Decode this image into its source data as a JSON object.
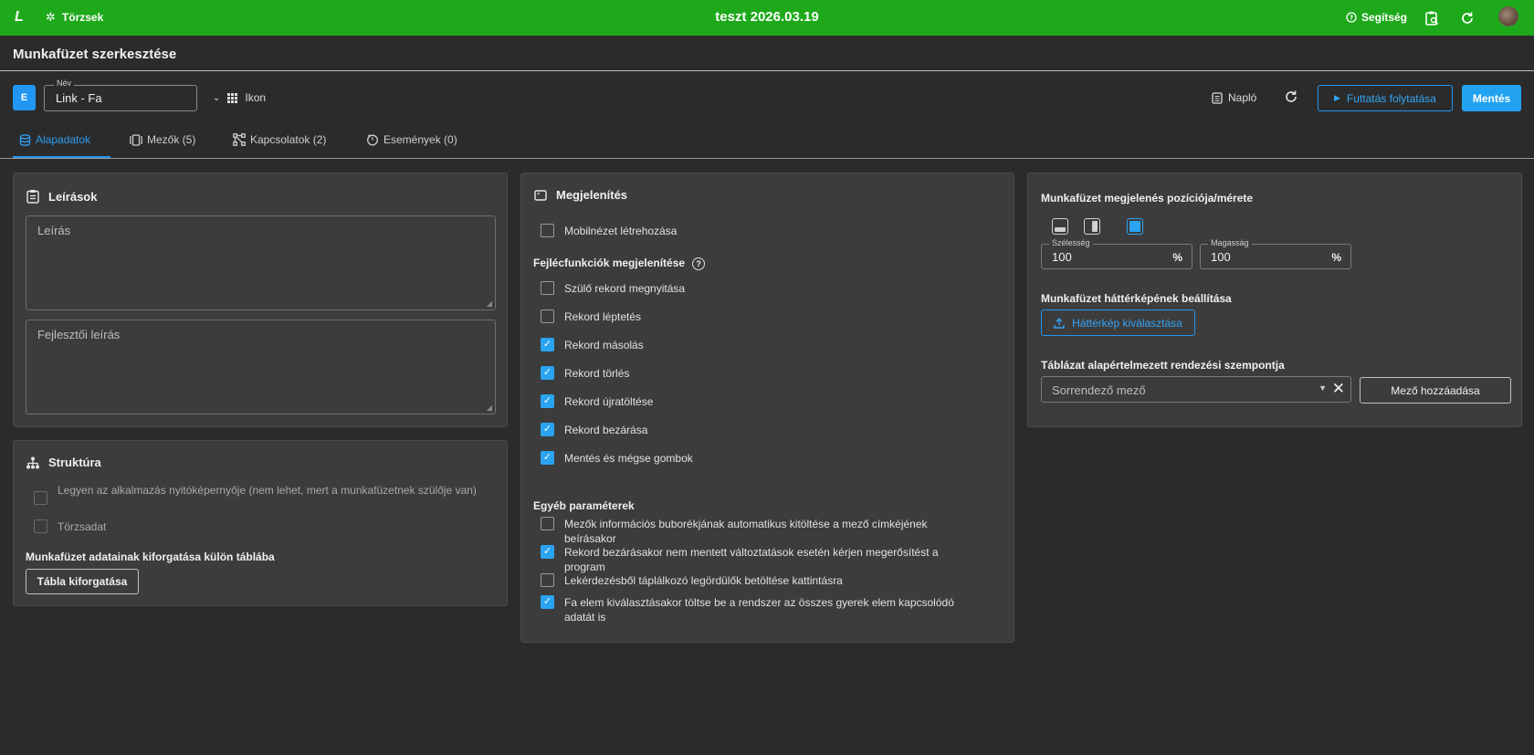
{
  "topbar": {
    "logo": "L",
    "torzsek_label": "Törzsek",
    "title": "teszt 2026.03.19",
    "help_label": "Segítség"
  },
  "header": {
    "page_title": "Munkafüzet szerkesztése",
    "badge": "E",
    "name_label": "Név",
    "name_value": "Link - Fa",
    "icon_label": "Ikon",
    "log_label": "Napló",
    "run_label": "Futtatás folytatása",
    "save_label": "Mentés"
  },
  "tabs": [
    {
      "label": "Alapadatok",
      "icon": "database-icon"
    },
    {
      "label": "Mezők (5)",
      "icon": "fields-icon"
    },
    {
      "label": "Kapcsolatok (2)",
      "icon": "relations-icon"
    },
    {
      "label": "Események (0)",
      "icon": "events-icon"
    }
  ],
  "descriptions": {
    "title": "Leírások",
    "desc_placeholder": "Leírás",
    "dev_desc_placeholder": "Fejlesztői leírás"
  },
  "structure": {
    "title": "Struktúra",
    "opt1": "Legyen az alkalmazás nyitóképernyője (nem lehet, mert a munkafüzetnek szülője van)",
    "opt2": "Törzsadat",
    "rotate_label": "Munkafüzet adatainak kiforgatása külön táblába",
    "rotate_button": "Tábla kiforgatása"
  },
  "display": {
    "title": "Megjelenítés",
    "mobile_view": "Mobilnézet létrehozása",
    "header_funcs_title": "Fejlécfunkciók megjelenítése",
    "header_funcs": [
      {
        "label": "Szülő rekord megnyitása",
        "checked": false
      },
      {
        "label": "Rekord léptetés",
        "checked": false
      },
      {
        "label": "Rekord másolás",
        "checked": true
      },
      {
        "label": "Rekord törlés",
        "checked": true
      },
      {
        "label": "Rekord újratöltése",
        "checked": true
      },
      {
        "label": "Rekord bezárása",
        "checked": true
      },
      {
        "label": "Mentés és mégse gombok",
        "checked": true
      }
    ],
    "other_title": "Egyéb paraméterek",
    "other_params": [
      {
        "label": "Mezők információs buborékjának automatikus kitöltése a mező címkéjének beírásakor",
        "checked": false
      },
      {
        "label": "Rekord bezárásakor nem mentett változtatások esetén kérjen megerősítést a program",
        "checked": true
      },
      {
        "label": "Lekérdezésből táplálkozó legördülők betöltése kattintásra",
        "checked": false
      },
      {
        "label": "Fa elem kiválasztásakor töltse be a rendszer az összes gyerek elem kapcsolódó adatát is",
        "checked": true
      }
    ]
  },
  "position": {
    "title": "Munkafüzet megjelenés pozíciója/mérete",
    "width_label": "Szélesség",
    "width_value": "100",
    "height_label": "Magasság",
    "height_value": "100",
    "unit": "%",
    "bg_title": "Munkafüzet háttérképének beállítása",
    "bg_button": "Háttérkép kiválasztása",
    "sort_title": "Táblázat alapértelmezett rendezési szempontja",
    "sort_placeholder": "Sorrendező mező",
    "add_field_button": "Mező hozzáadása"
  },
  "colors": {
    "topbar": "#1ea91b",
    "accent": "#2196f3",
    "background": "#2b2b2b",
    "card": "#3c3c3c"
  }
}
